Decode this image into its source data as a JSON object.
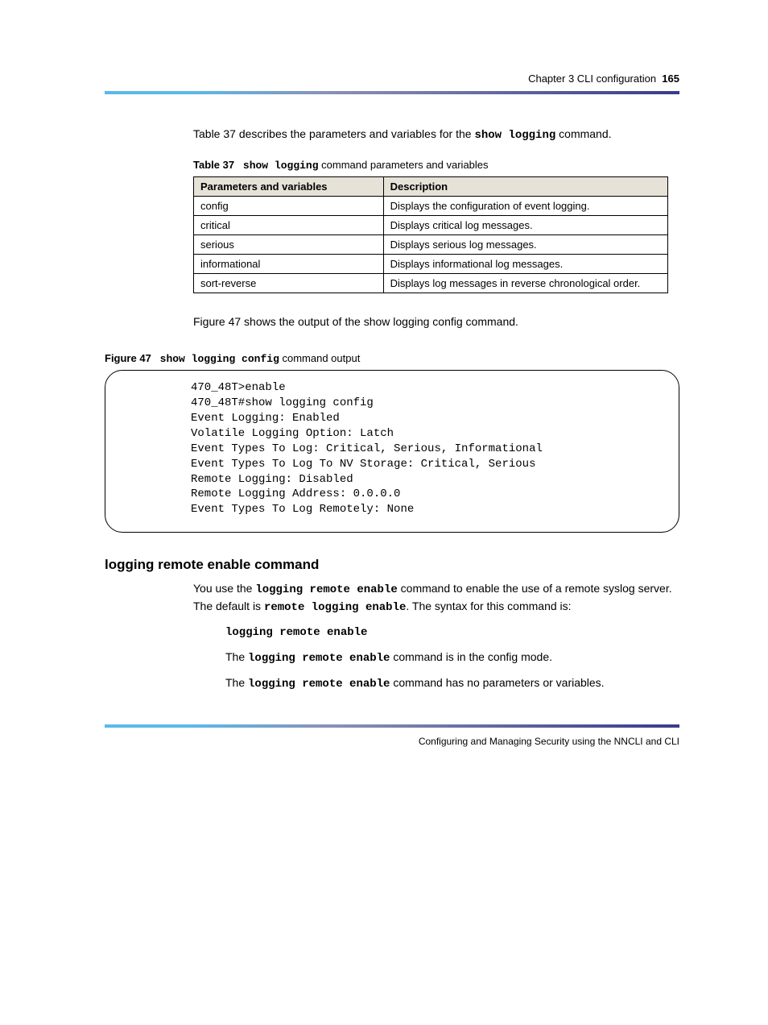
{
  "header": {
    "running_head": "Chapter 3 CLI configuration",
    "page_number": "165"
  },
  "intro": {
    "line1_pre": "Table 37",
    "line1_post": " describes the parameters and variables for the ",
    "cmd1": "show logging",
    "line1_end": " command."
  },
  "table37": {
    "caption_bold": "Table 37",
    "caption_code": "show logging",
    "caption_rest": " command parameters and variables",
    "headers": [
      "Parameters and variables",
      "Description"
    ],
    "rows": [
      [
        "config",
        "Displays the configuration of event logging."
      ],
      [
        "critical",
        "Displays critical log messages."
      ],
      [
        "serious",
        "Displays serious log messages."
      ],
      [
        "informational",
        "Displays informational log messages."
      ],
      [
        "sort-reverse",
        "Displays log messages in reverse chronological order."
      ]
    ]
  },
  "midtext": "Figure 47 shows the output of the show logging config command.",
  "figure47": {
    "caption_bold": "Figure 47",
    "caption_code": "show logging config",
    "caption_rest": " command output",
    "content": "470_48T>enable\n470_48T#show logging config\nEvent Logging: Enabled\nVolatile Logging Option: Latch\nEvent Types To Log: Critical, Serious, Informational\nEvent Types To Log To NV Storage: Critical, Serious\nRemote Logging: Disabled\nRemote Logging Address: 0.0.0.0\nEvent Types To Log Remotely: None"
  },
  "section": {
    "title": "logging remote enable command",
    "para_pre": "You use the ",
    "cmd1": "logging remote enable",
    "para_mid": " command to enable the use of a remote syslog server. The default is ",
    "cmd2": "remote logging enable",
    "para_end": ". The syntax for this command is:",
    "syntax": "logging remote enable",
    "line2_pre": "The ",
    "line2_cmd": "logging remote enable",
    "line2_post": " command is in the config mode.",
    "line3_pre": "The ",
    "line3_cmd": "logging remote enable",
    "line3_post": " command has no parameters or variables."
  },
  "footer": {
    "text": "Configuring and Managing Security using the NNCLI and CLI"
  }
}
